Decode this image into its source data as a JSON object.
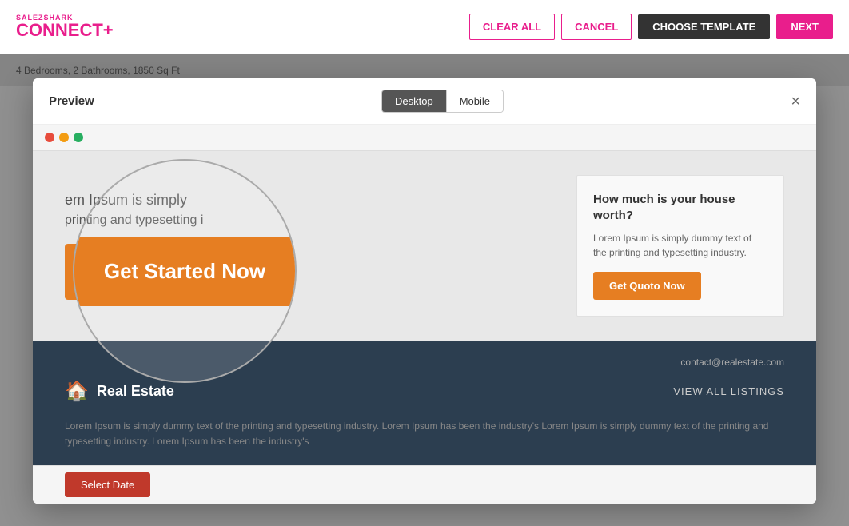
{
  "app": {
    "logo_top": "SALEZ",
    "logo_top_accent": "SHARK",
    "logo_bottom": "CONNECT",
    "logo_plus": "+"
  },
  "nav": {
    "clear_all_label": "CLEAR ALL",
    "cancel_label": "CANCEL",
    "choose_template_label": "CHOOSE TEMPLATE",
    "next_label": "NEXT"
  },
  "modal": {
    "title": "Preview",
    "close_label": "×",
    "view_desktop_label": "Desktop",
    "view_mobile_label": "Mobile"
  },
  "preview": {
    "hero_text_top": "em Ipsum is simply",
    "hero_text_sub": "printing and typesetting i",
    "cta_main_label": "Get Started Now",
    "sidebar_title": "How much is your house worth?",
    "sidebar_body": "Lorem Ipsum is simply dummy text of the printing and typesetting industry.",
    "sidebar_cta_label": "Get Quoto Now",
    "footer_contact": "contact@realestate.com",
    "footer_logo_text": "Real Estate",
    "footer_link": "VIEW ALL LISTINGS",
    "footer_body": "Lorem Ipsum is simply dummy text of the printing and typesetting industry. Lorem Ipsum has been the industry's Lorem Ipsum is simply dummy text of the printing and typesetting industry. Lorem Ipsum has been the industry's"
  },
  "bg": {
    "bar_text": "4 Bedrooms, 2 Bathrooms, 1850 Sq Ft"
  }
}
